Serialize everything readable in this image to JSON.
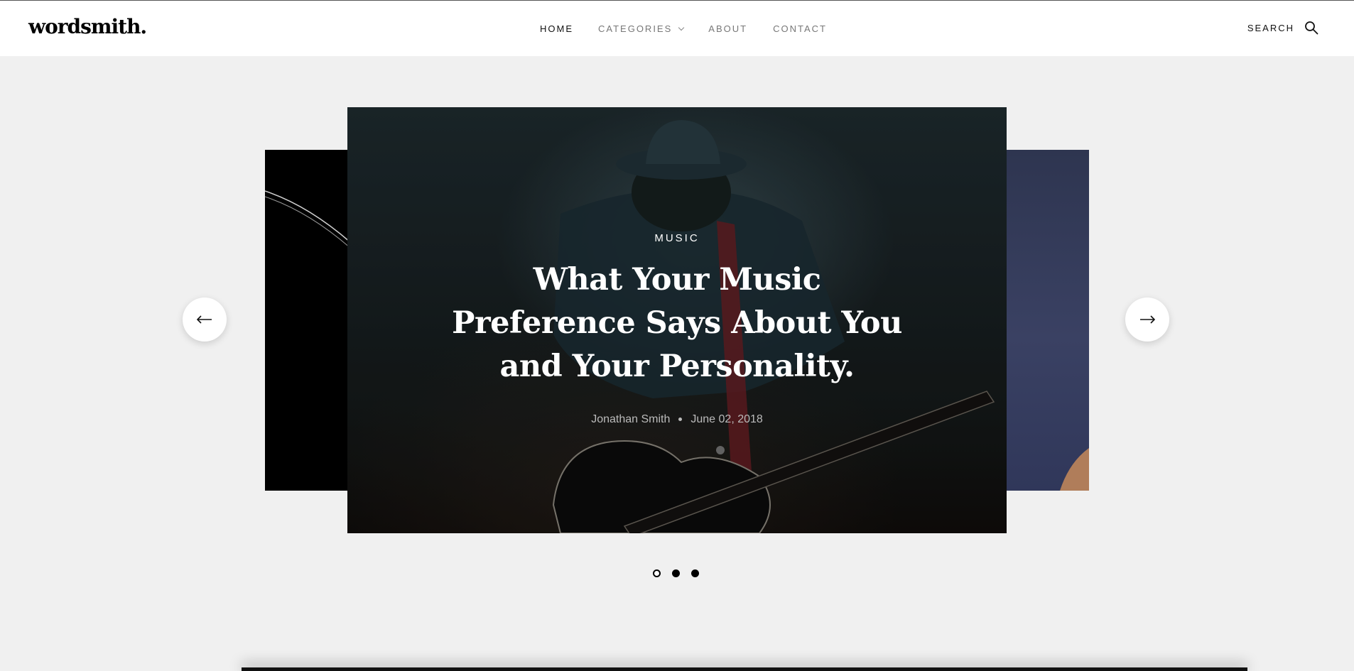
{
  "site": {
    "logo": "wordsmith."
  },
  "nav": {
    "items": [
      {
        "label": "HOME",
        "active": true
      },
      {
        "label": "CATEGORIES",
        "has_dropdown": true
      },
      {
        "label": "ABOUT"
      },
      {
        "label": "CONTACT"
      }
    ],
    "search_label": "SEARCH",
    "search_icon": "search-icon"
  },
  "slider": {
    "current": {
      "category": "MUSIC",
      "title": "What Your Music Preference Says About You and Your Personality.",
      "author": "Jonathan Smith",
      "date": "June 02, 2018"
    },
    "prev_icon": "arrow-left-icon",
    "next_icon": "arrow-right-icon",
    "dots": [
      {
        "active": true
      },
      {
        "active": false
      },
      {
        "active": false
      }
    ]
  },
  "colors": {
    "background": "#f0f0f0",
    "header_bg": "#ffffff",
    "text_dark": "#111111",
    "nav_muted": "#777777",
    "meta_text": "#bbbbbb"
  }
}
